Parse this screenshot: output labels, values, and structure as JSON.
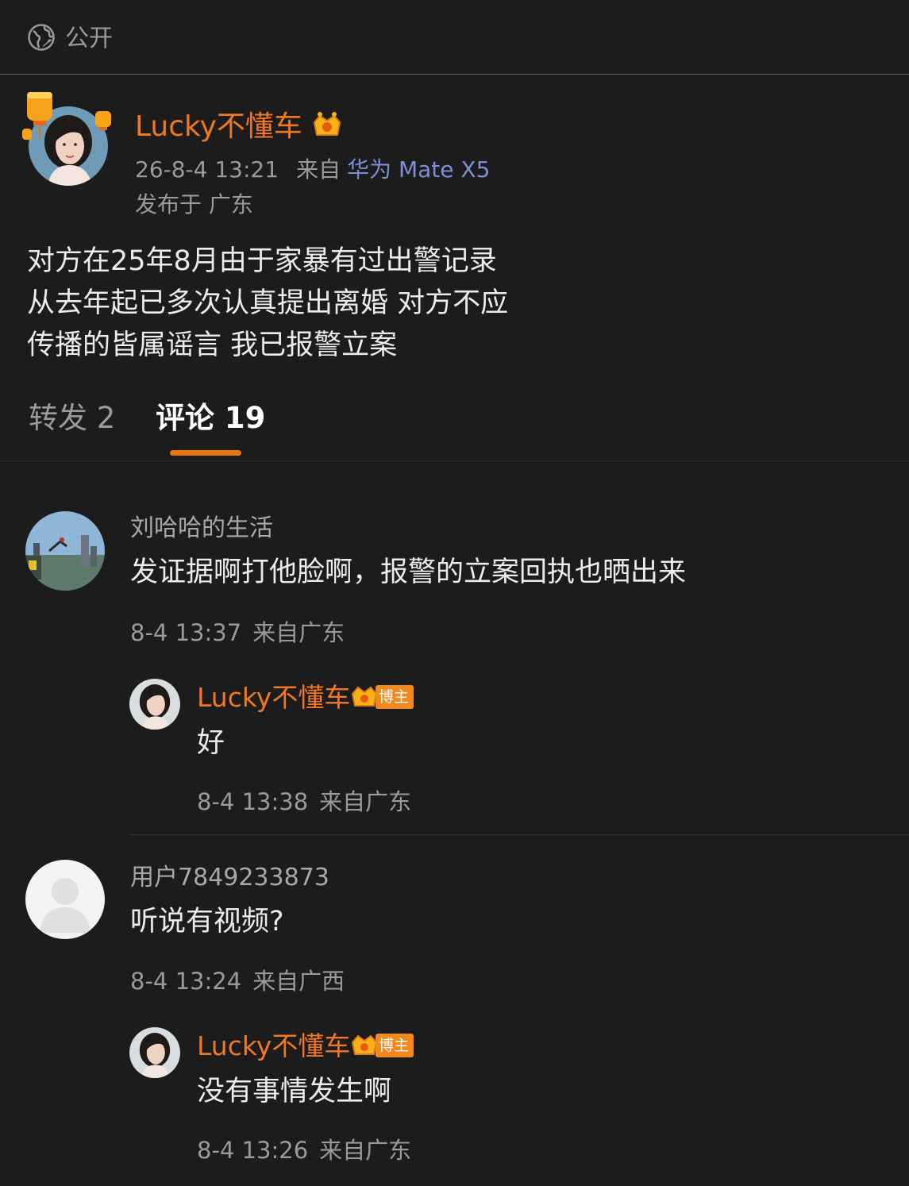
{
  "visibility": {
    "label": "公开",
    "icon": "globe-icon"
  },
  "post": {
    "author": "Lucky不懂车",
    "time": "26-8-4 13:21",
    "source_label": "来自",
    "device": "华为 Mate X5",
    "location": "发布于 广东",
    "lines": [
      "对方在25年8月由于家暴有过出警记录",
      "从去年起已多次认真提出离婚 对方不应",
      "传播的皆属谣言 我已报警立案"
    ]
  },
  "tabs": {
    "reposts": "转发 2",
    "comments": "评论 19"
  },
  "comments": [
    {
      "user": "刘哈哈的生活",
      "text": "发证据啊打他脸啊，报警的立案回执也晒出来",
      "time": "8-4 13:37",
      "source": "来自广东",
      "reply": {
        "user": "Lucky不懂车",
        "badge": "博主",
        "text": "好",
        "time": "8-4 13:38",
        "source": "来自广东"
      }
    },
    {
      "user": "用户7849233873",
      "text": "听说有视频?",
      "time": "8-4 13:24",
      "source": "来自广西",
      "reply": {
        "user": "Lucky不懂车",
        "badge": "博主",
        "text": "没有事情发生啊",
        "time": "8-4 13:26",
        "source": "来自广东"
      }
    }
  ],
  "colors": {
    "background": "#1c1c1c",
    "author_orange": "#f0781e",
    "device_blue": "#7c8fd6",
    "tab_underline": "#e8740f"
  }
}
